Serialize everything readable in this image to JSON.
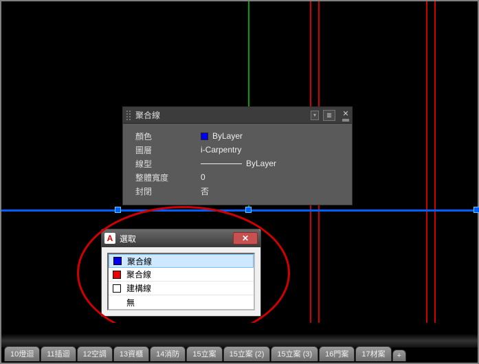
{
  "properties_panel": {
    "title": "聚合線",
    "cui_label": "▥",
    "dropdown_glyph": "▾",
    "close_glyph": "✕",
    "rows": {
      "color_label": "顏色",
      "color_value": "ByLayer",
      "layer_label": "圖層",
      "layer_value": "i-Carpentry",
      "linetype_label": "線型",
      "linetype_value": "ByLayer",
      "width_label": "整體寬度",
      "width_value": "0",
      "closed_label": "封閉",
      "closed_value": "否"
    }
  },
  "select_dialog": {
    "logo_glyph": "A",
    "title": "選取",
    "close_glyph": "✕",
    "items": [
      {
        "color": "blue",
        "label": "聚合線",
        "selected": true
      },
      {
        "color": "red",
        "label": "聚合線",
        "selected": false
      },
      {
        "color": "white",
        "label": "建構線",
        "selected": false
      }
    ],
    "none_label": "無"
  },
  "tabs": [
    "10燈迴",
    "11插迴",
    "12空調",
    "13資櫃",
    "14消防",
    "15立案",
    "15立案 (2)",
    "15立案 (3)",
    "16門案",
    "17材案"
  ],
  "tab_plus": "+"
}
